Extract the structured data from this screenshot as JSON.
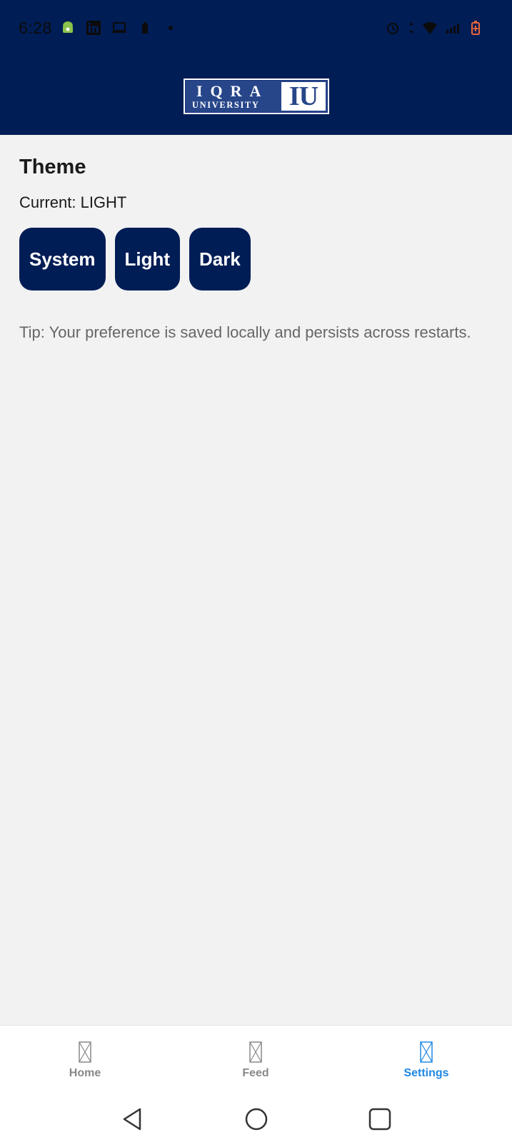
{
  "status_bar": {
    "time": "6:28",
    "left_icons": [
      "android-icon",
      "linkedin-icon",
      "laptop-icon",
      "battery-saver-icon",
      "dot-icon"
    ],
    "right_icons": [
      "alarm-icon",
      "data-arrows-icon",
      "wifi-icon",
      "signal-icon",
      "battery-charging-icon"
    ],
    "battery_color": "#e8643a"
  },
  "header": {
    "logo": {
      "main": "IQRA",
      "sub": "UNIVERSITY",
      "mark": "IU"
    },
    "background": "#011d55"
  },
  "theme": {
    "title": "Theme",
    "current": "Current: LIGHT",
    "buttons": [
      {
        "label": "System"
      },
      {
        "label": "Light"
      },
      {
        "label": "Dark"
      }
    ],
    "tip": "Tip: Your preference is saved locally and persists across restarts."
  },
  "bottom_nav": {
    "items": [
      {
        "label": "Home",
        "icon": "placeholder-icon",
        "active": false
      },
      {
        "label": "Feed",
        "icon": "placeholder-icon",
        "active": false
      },
      {
        "label": "Settings",
        "icon": "placeholder-icon",
        "active": true
      }
    ],
    "active_color": "#1e88e5",
    "inactive_color": "#888888"
  },
  "system_nav": {
    "buttons": [
      "back-icon",
      "home-circle-icon",
      "recents-icon"
    ]
  }
}
